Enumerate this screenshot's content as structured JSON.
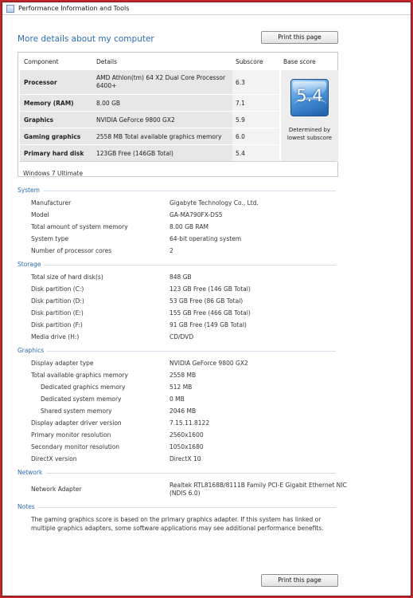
{
  "window": {
    "title": "Performance Information and Tools"
  },
  "header": {
    "heading": "More details about my computer",
    "print_label": "Print this page"
  },
  "scores": {
    "headers": {
      "component": "Component",
      "details": "Details",
      "subscore": "Subscore",
      "base": "Base score"
    },
    "rows": [
      {
        "component": "Processor",
        "details": "AMD Athlon(tm) 64 X2 Dual Core Processor 6400+",
        "subscore": "6.3"
      },
      {
        "component": "Memory (RAM)",
        "details": "8.00 GB",
        "subscore": "7.1"
      },
      {
        "component": "Graphics",
        "details": "NVIDIA GeForce 9800 GX2",
        "subscore": "5.9"
      },
      {
        "component": "Gaming graphics",
        "details": "2558 MB Total available graphics memory",
        "subscore": "6.0"
      },
      {
        "component": "Primary hard disk",
        "details": "123GB Free (146GB Total)",
        "subscore": "5.4"
      }
    ],
    "base_score": "5.4",
    "base_note": "Determined by lowest subscore",
    "os": "Windows 7 Ultimate"
  },
  "system": {
    "title": "System",
    "items": [
      {
        "key": "Manufacturer",
        "value": "Gigabyte Technology Co., Ltd."
      },
      {
        "key": "Model",
        "value": "GA-MA790FX-DS5"
      },
      {
        "key": "Total amount of system memory",
        "value": "8.00 GB RAM"
      },
      {
        "key": "System type",
        "value": "64-bit operating system"
      },
      {
        "key": "Number of processor cores",
        "value": "2"
      }
    ]
  },
  "storage": {
    "title": "Storage",
    "items": [
      {
        "key": "Total size of hard disk(s)",
        "value": "848 GB"
      },
      {
        "key": "Disk partition (C:)",
        "value": "123 GB Free (146 GB Total)"
      },
      {
        "key": "Disk partition (D:)",
        "value": "53 GB Free (86 GB Total)"
      },
      {
        "key": "Disk partition (E:)",
        "value": "155 GB Free (466 GB Total)"
      },
      {
        "key": "Disk partition (F:)",
        "value": "91 GB Free (149 GB Total)"
      },
      {
        "key": "Media drive (H:)",
        "value": "CD/DVD"
      }
    ]
  },
  "graphics": {
    "title": "Graphics",
    "items": [
      {
        "key": "Display adapter type",
        "value": "NVIDIA GeForce 9800 GX2"
      },
      {
        "key": "Total available graphics memory",
        "value": "2558 MB"
      },
      {
        "key": "Dedicated graphics memory",
        "value": "512 MB"
      },
      {
        "key": "Dedicated system memory",
        "value": "0 MB"
      },
      {
        "key": "Shared system memory",
        "value": "2046 MB"
      },
      {
        "key": "Display adapter driver version",
        "value": "7.15.11.8122"
      },
      {
        "key": "Primary monitor resolution",
        "value": "2560x1600"
      },
      {
        "key": "Secondary monitor resolution",
        "value": "1050x1680"
      },
      {
        "key": "DirectX version",
        "value": "DirectX 10"
      }
    ]
  },
  "network": {
    "title": "Network",
    "items": [
      {
        "key": "Network Adapter",
        "value_line1": "Realtek RTL8168B/8111B Family PCI-E Gigabit Ethernet NIC",
        "value_line2": "(NDIS 6.0)"
      }
    ]
  },
  "notes": {
    "title": "Notes",
    "text": "The gaming graphics score is based on the primary graphics adapter. If this system has linked or multiple graphics adapters, some software applications may see additional performance benefits."
  }
}
